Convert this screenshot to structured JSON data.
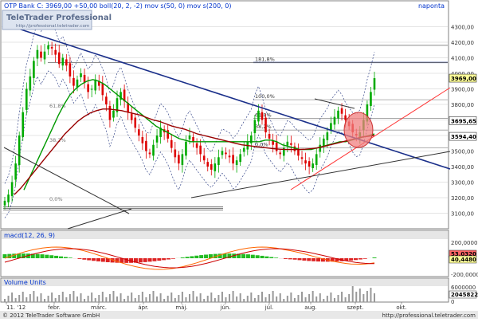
{
  "header": {
    "text": "OTP Bank  C: 3969,00  +50,00  boll(20, 2, -2)  mov s(50, 0)  mov s(200, 0)",
    "interval": "naponta"
  },
  "watermark": {
    "brand": "TeleTrader Professional",
    "url": "http://professional.teletrader.com"
  },
  "footer": {
    "copyright": "© 2012 TeleTrader Software GmbH",
    "url": "http://professional.teletrader.com"
  },
  "colors": {
    "up": "#00aa00",
    "down": "#dd0000",
    "ma50": "#009900",
    "ma200": "#990000",
    "trendline": "#1a2f8a",
    "support": "#ff3333",
    "bollinger": "#334488",
    "ellipse": "#f08080",
    "price_badge": "#ffff99"
  },
  "chart_data": [
    {
      "type": "candlestick",
      "series_name": "OTP Bank",
      "ylim": [
        3000,
        4400
      ],
      "yticks": [
        "3100,00",
        "3200,00",
        "3300,00",
        "3400,00",
        "3500,00",
        "3600,00",
        "3700,00",
        "3800,00",
        "3900,00",
        "4000,00",
        "4100,00",
        "4200,00",
        "4300,00"
      ],
      "xticks": [
        "11. '12",
        "febr.",
        "márc.",
        "ápr.",
        "máj.",
        "jún.",
        "júl.",
        "aug.",
        "szept.",
        "okt."
      ],
      "price_labels": [
        {
          "label": "3969,00",
          "value": 3969
        },
        {
          "label": "3695,65",
          "value": 3695.65
        },
        {
          "label": "3594,40",
          "value": 3594.4
        }
      ],
      "fib_levels": [
        {
          "label": "181,8%",
          "value": 4070
        },
        {
          "label": "100,0%",
          "value": 3830
        },
        {
          "label": "61,8%",
          "value": 3710
        },
        {
          "label": "38,2%",
          "value": 3635
        },
        {
          "label": "0,0%",
          "value": 3520
        }
      ],
      "fib_levels_left": [
        {
          "label": "61,8%",
          "value": 3780
        },
        {
          "label": "38,2%",
          "value": 3560
        },
        {
          "label": "0,0%",
          "value": 3180
        }
      ],
      "close": [
        3180,
        3220,
        3300,
        3420,
        3600,
        3750,
        3900,
        3980,
        4080,
        4150,
        4100,
        4140,
        4180,
        4160,
        4120,
        4060,
        4100,
        4050,
        3980,
        3920,
        3960,
        4000,
        3940,
        3880,
        3900,
        3960,
        3920,
        3860,
        3800,
        3700,
        3760,
        3840,
        3880,
        3820,
        3750,
        3700,
        3650,
        3600,
        3550,
        3500,
        3480,
        3540,
        3600,
        3650,
        3620,
        3580,
        3520,
        3460,
        3420,
        3480,
        3560,
        3600,
        3560,
        3520,
        3480,
        3440,
        3400,
        3380,
        3420,
        3460,
        3500,
        3480,
        3460,
        3420,
        3440,
        3480,
        3520,
        3560,
        3600,
        3700,
        3760,
        3700,
        3620,
        3580,
        3540,
        3500,
        3480,
        3520,
        3560,
        3540,
        3500,
        3470,
        3450,
        3420,
        3400,
        3420,
        3480,
        3540,
        3580,
        3620,
        3680,
        3720,
        3760,
        3740,
        3700,
        3660,
        3620,
        3600,
        3620,
        3700,
        3800,
        3880,
        3969
      ],
      "ma50": [
        3250,
        3330,
        3410,
        3490,
        3570,
        3650,
        3730,
        3800,
        3860,
        3900,
        3930,
        3950,
        3960,
        3950,
        3930,
        3900,
        3870,
        3840,
        3810,
        3780,
        3750,
        3720,
        3690,
        3660,
        3640,
        3620,
        3600,
        3580,
        3570,
        3560,
        3560,
        3560,
        3560,
        3560,
        3560,
        3560,
        3560,
        3560,
        3560,
        3560,
        3560,
        3560,
        3570,
        3570,
        3560,
        3540,
        3530,
        3520,
        3510,
        3510,
        3510,
        3520,
        3530,
        3540,
        3550,
        3560,
        3560,
        3570,
        3580,
        3590,
        3600,
        3610
      ],
      "ma200": [
        3220,
        3260,
        3310,
        3360,
        3410,
        3460,
        3510,
        3560,
        3610,
        3650,
        3690,
        3720,
        3745,
        3760,
        3770,
        3770,
        3765,
        3760,
        3750,
        3740,
        3730,
        3715,
        3700,
        3690,
        3675,
        3660,
        3650,
        3640,
        3625,
        3610,
        3600,
        3590,
        3580,
        3570,
        3560,
        3550,
        3540,
        3535,
        3530,
        3525,
        3520,
        3515,
        3512,
        3510,
        3510,
        3510,
        3512,
        3515,
        3520,
        3530,
        3540,
        3550,
        3560,
        3570,
        3580,
        3590,
        3595,
        3600
      ]
    },
    {
      "type": "line",
      "title": "macd(12, 26, 9)",
      "yticks": [
        "200,0000",
        "0,0000",
        "-200,0000"
      ],
      "value_labels": [
        "53,0320",
        "40,4480"
      ]
    },
    {
      "type": "bar",
      "title": "Volume Units",
      "yticks": [
        "6000000",
        "0"
      ],
      "value_label": "2045822"
    }
  ]
}
